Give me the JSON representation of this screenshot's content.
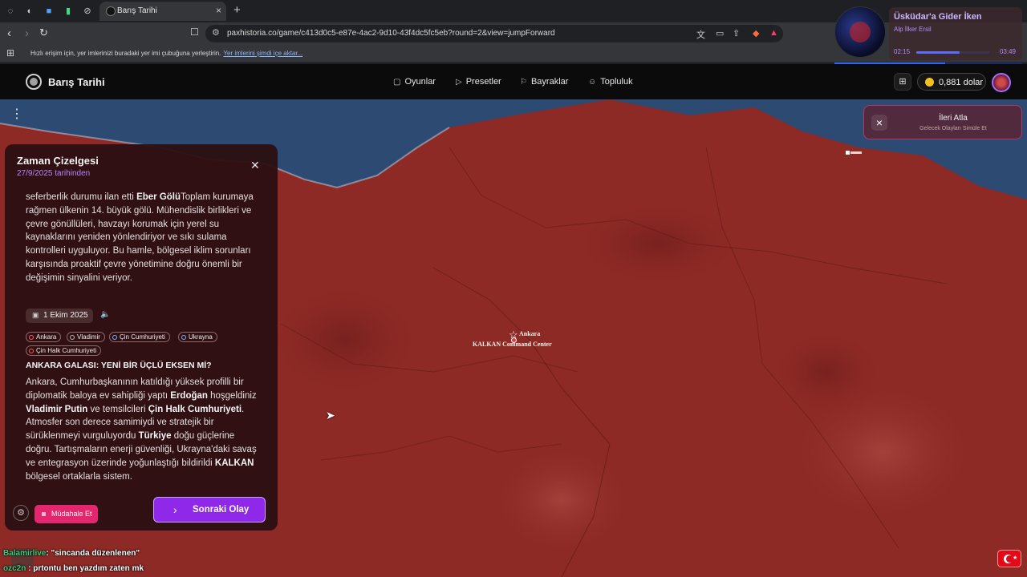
{
  "browser": {
    "tab_title": "Barış Tarihi",
    "url": "paxhistoria.co/game/c413d0c5-e87e-4ac2-9d10-43f4dc5fc5eb?round=2&view=jumpForward",
    "bookmarks_message": "Hızlı erişim için, yer imlerinizi buradaki yer imi çubuğuna yerleştirin.",
    "bookmarks_link": "Yer imlerini şimdi içe aktar..."
  },
  "media": {
    "title": "Üsküdar'a Gider İken",
    "artist": "Alp İlker Ersil",
    "time_current": "02:15",
    "time_total": "03:49",
    "progress": 0.59
  },
  "app": {
    "brand": "Barış Tarihi",
    "nav": [
      {
        "label": "Oyunlar",
        "icon": "gamepad-icon"
      },
      {
        "label": "Presetler",
        "icon": "play-icon"
      },
      {
        "label": "Bayraklar",
        "icon": "flag-icon"
      },
      {
        "label": "Topluluk",
        "icon": "users-icon"
      }
    ],
    "balance": "0,881 dolar"
  },
  "skip_forward": {
    "title": "İleri Atla",
    "subtitle": "Gelecek Olayları Simüle Et"
  },
  "map": {
    "city_label": "Ankara",
    "hq_label": "KALKAN Command Center",
    "colors": {
      "territory": "#8e2a26",
      "sea": "#2d4a72"
    }
  },
  "timeline": {
    "title": "Zaman Çizelgesi",
    "subtitle": "27/9/2025 tarihinden",
    "entry1": {
      "p1": "seferberlik durumu ilan etti ",
      "b1": "Eber Gölü",
      "p2": "Toplam kurumaya rağmen ülkenin 14. büyük gölü. Mühendislik birlikleri ve çevre gönüllüleri, havzayı korumak için yerel su kaynaklarını yeniden yönlendiriyor ve sıkı sulama kontrolleri uyguluyor. Bu hamle, bölgesel iklim sorunları karşısında proaktif çevre yönetimine doğru önemli bir değişimin sinyalini veriyor."
    },
    "entry2": {
      "date": "1 Ekim 2025",
      "tags": [
        {
          "label": "Ankara",
          "color": "#ff5a5a"
        },
        {
          "label": "Vladimir",
          "color": "#b6b6b6"
        },
        {
          "label": "Çin Cumhuriyeti",
          "color": "#7fb2ff"
        },
        {
          "label": "Ukrayna",
          "color": "#7fb2ff"
        },
        {
          "label": "Çin Halk Cumhuriyeti",
          "color": "#ff5a5a"
        }
      ],
      "headline": "ANKARA GALASI: YENİ BİR ÜÇLÜ EKSEN Mİ?",
      "s1": "Ankara, Cumhurbaşkanının katıldığı yüksek profilli bir diplomatik baloya ev sahipliği yaptı ",
      "b1": "Erdoğan",
      "s2": " hoşgeldiniz ",
      "b2": "Vladimir Putin",
      "s3": " ve temsilcileri ",
      "b3": "Çin Halk Cumhuriyeti",
      "s4": ". Atmosfer son derece samimiydi ve stratejik bir sürüklenmeyi vurguluyordu ",
      "b4": "Türkiye",
      "s5": " doğu güçlerine doğru. Tartışmaların enerji güvenliği, Ukrayna'daki savaş ve entegrasyon üzerinde yoğunlaştığı bildirildi ",
      "b5": "KALKAN",
      "s6": " bölgesel ortaklarla sistem."
    },
    "intervene_label": "Müdahale Et",
    "next_label": "Sonraki Olay"
  },
  "chat": [
    {
      "user": "Balamirlive",
      "text": ": \"sincanda düzenlenen\""
    },
    {
      "user": "ozc2n",
      "text": " : prtontu ben yazdım zaten mk"
    }
  ]
}
